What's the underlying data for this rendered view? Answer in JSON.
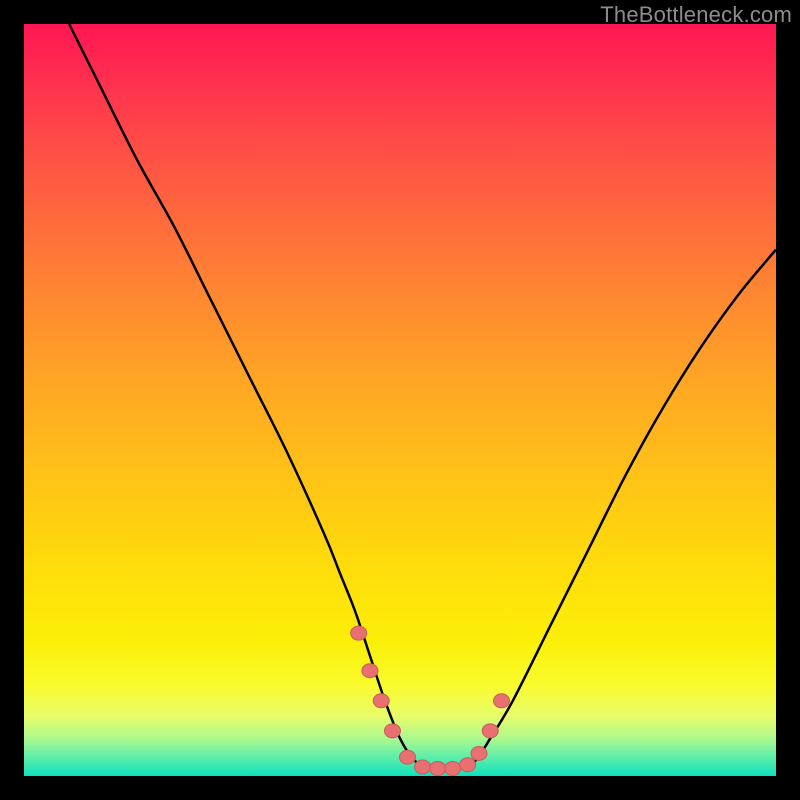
{
  "watermark_text": "TheBottleneck.com",
  "chart_data": {
    "type": "line",
    "title": "",
    "xlabel": "",
    "ylabel": "",
    "xlim": [
      0,
      100
    ],
    "ylim": [
      0,
      100
    ],
    "grid": false,
    "series": [
      {
        "name": "bottleneck-curve",
        "x": [
          6,
          10,
          15,
          20,
          25,
          30,
          35,
          40,
          42,
          44,
          46,
          48,
          50,
          52,
          54,
          56,
          58,
          60,
          62,
          65,
          70,
          75,
          80,
          85,
          90,
          95,
          100
        ],
        "values": [
          100,
          92,
          82,
          73,
          63,
          53,
          43,
          32,
          27,
          22,
          16,
          10,
          5,
          2,
          1,
          1,
          1,
          2,
          5,
          10,
          20,
          30,
          40,
          49,
          57,
          64,
          70
        ]
      }
    ],
    "markers": {
      "name": "highlighted-points",
      "x": [
        44.5,
        46,
        47.5,
        49,
        51,
        53,
        55,
        57,
        59,
        60.5,
        62,
        63.5
      ],
      "values": [
        19,
        14,
        10,
        6,
        2.5,
        1.2,
        1,
        1,
        1.5,
        3,
        6,
        10
      ]
    }
  },
  "colors": {
    "curve_stroke": "#000000",
    "marker_fill": "#e97070",
    "marker_stroke": "#c85b5b",
    "frame_background": "#000000",
    "watermark": "#8d8d8d"
  }
}
